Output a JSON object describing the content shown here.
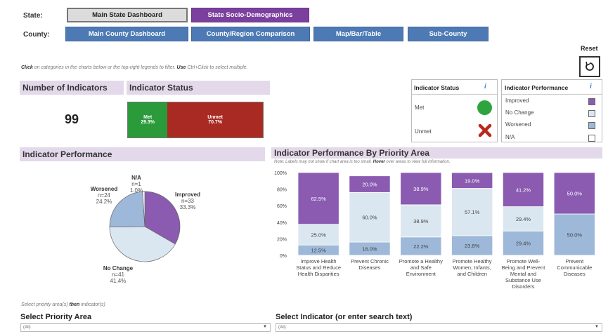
{
  "nav": {
    "state_label": "State:",
    "county_label": "County:",
    "state_buttons": [
      "Main State Dashboard",
      "State Socio-Demographics"
    ],
    "county_buttons": [
      "Main County Dashboard",
      "County/Region Comparison",
      "Map/Bar/Table",
      "Sub-County"
    ]
  },
  "reset": {
    "label": "Reset",
    "icon": "refresh-icon"
  },
  "hint": {
    "click": "Click",
    "text1": " on categories in the charts below or the top-right legends to filter. ",
    "use": "Use",
    "text2": " Ctrl+Click to select multiple."
  },
  "indicators": {
    "title": "Number of Indicators",
    "count": "99"
  },
  "indicator_status": {
    "title": "Indicator Status",
    "met_label": "Met",
    "met_pct": "29.3%",
    "unmet_label": "Unmet",
    "unmet_pct": "70.7%"
  },
  "status_legend": {
    "title": "Indicator Status",
    "info_icon": "i",
    "items": [
      {
        "label": "Met",
        "icon": "green-circle-icon"
      },
      {
        "label": "Unmet",
        "icon": "red-x-icon"
      }
    ]
  },
  "performance_legend": {
    "title": "Indicator Performance",
    "info_icon": "i",
    "items": [
      {
        "label": "Improved",
        "color": "#8a5bb0"
      },
      {
        "label": "No Change",
        "color": "#dbe7f0"
      },
      {
        "label": "Worsened",
        "color": "#9db8d8"
      },
      {
        "label": "N/A",
        "color": "#ffffff"
      }
    ]
  },
  "pie_panel": {
    "title": "Indicator Performance"
  },
  "bar_panel": {
    "title": "Indicator Performance By Priority Area",
    "note_prefix": "Note: Labels may not show if chart area is too small. ",
    "note_hover": "Hover",
    "note_suffix": " over areas to view full information."
  },
  "filters": {
    "hint_prefix": "Select priority area(s) ",
    "hint_then": "then",
    "hint_suffix": " indicator(s)",
    "priority_title": "Select Priority Area",
    "priority_value": "(All)",
    "indicator_title": "Select Indicator (or enter search text)",
    "indicator_value": "(All)"
  },
  "chart_data": [
    {
      "type": "pie",
      "slices": [
        {
          "label": "Improved",
          "n": "n=33",
          "value": 33.3,
          "color": "#8a5bb0"
        },
        {
          "label": "No Change",
          "n": "n=41",
          "value": 41.4,
          "color": "#dbe7f0"
        },
        {
          "label": "Worsened",
          "n": "n=24",
          "value": 24.2,
          "color": "#9db8d8"
        },
        {
          "label": "N/A",
          "n": "n=1",
          "value": 1.0,
          "color": "#ffffff"
        }
      ]
    },
    {
      "type": "bar",
      "stacked": true,
      "ylim": [
        0,
        100
      ],
      "yticks": [
        "0%",
        "20%",
        "40%",
        "60%",
        "80%",
        "100%"
      ],
      "categories": [
        [
          "Improve Health",
          "Status and Reduce",
          "Health Disparities"
        ],
        [
          "Prevent Chronic",
          "Diseases"
        ],
        [
          "Promote a Healthy",
          "and Safe",
          "Environment"
        ],
        [
          "Promote Healthy",
          "Women, Infants,",
          "and Children"
        ],
        [
          "Promote Well-",
          "Being and Prevent",
          "Mental and",
          "Substance Use",
          "Disorders"
        ],
        [
          "Prevent",
          "Communicable",
          "Diseases"
        ]
      ],
      "series": [
        {
          "name": "Worsened",
          "color": "#9db8d8",
          "values": [
            12.5,
            16.0,
            22.2,
            23.8,
            29.4,
            50.0
          ]
        },
        {
          "name": "No Change",
          "color": "#dbe7f0",
          "values": [
            25.0,
            60.0,
            38.9,
            57.1,
            29.4,
            0
          ]
        },
        {
          "name": "Improved",
          "color": "#8a5bb0",
          "values": [
            62.5,
            20.0,
            38.9,
            19.0,
            41.2,
            50.0
          ]
        }
      ],
      "labels": [
        [
          "12.5%",
          "25.0%",
          "62.5%"
        ],
        [
          "16.0%",
          "60.0%",
          "20.0%"
        ],
        [
          "22.2%",
          "38.9%",
          "38.9%"
        ],
        [
          "23.8%",
          "57.1%",
          "19.0%"
        ],
        [
          "29.4%",
          "29.4%",
          "41.2%"
        ],
        [
          "50.0%",
          "",
          "50.0%"
        ]
      ]
    }
  ]
}
